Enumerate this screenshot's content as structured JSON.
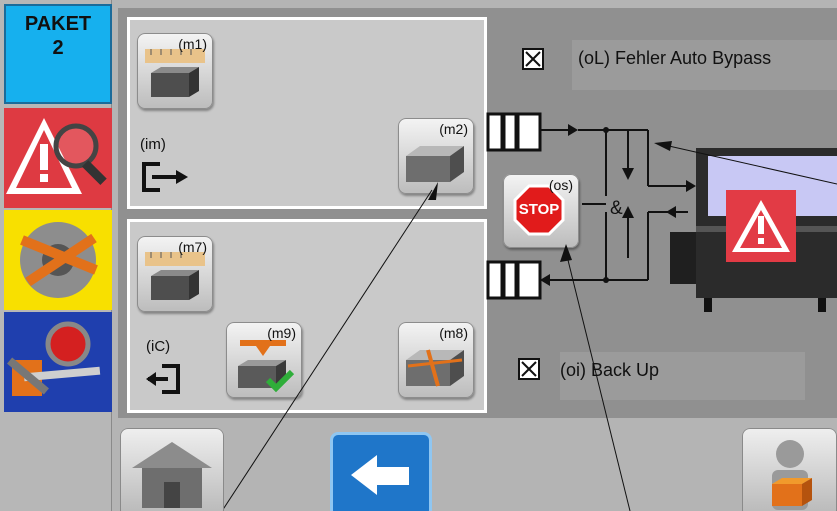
{
  "sidebar": {
    "paket_label": "PAKET",
    "paket_number": "2",
    "buttons": [
      {
        "name": "error-search",
        "color": "#de3a42",
        "icon": "warning-search-icon"
      },
      {
        "name": "wrap-roll",
        "color": "#f8e000",
        "icon": "film-roll-icon"
      },
      {
        "name": "search-tool",
        "color": "#1f3fae",
        "icon": "magnifier-tool-icon"
      }
    ]
  },
  "panel_top": {
    "m1_label": "(m1)",
    "m2_label": "(m2)",
    "mode_label": "(im)"
  },
  "panel_bottom": {
    "m7_label": "(m7)",
    "m8_label": "(m8)",
    "m9_label": "(m9)",
    "mode_label": "(iC)"
  },
  "stop": {
    "label": "(os)",
    "text": "STOP"
  },
  "logic": {
    "and_symbol": "&"
  },
  "options": {
    "auto_bypass": {
      "label": "(oL) Fehler Auto Bypass",
      "checked": true
    },
    "back_up": {
      "label": "(oi) Back Up",
      "checked": true
    }
  },
  "nav": {
    "home_icon": "house-icon",
    "back_icon": "arrow-left-icon",
    "user_icon": "operator-icon"
  },
  "colors": {
    "accent_blue": "#16b0ee",
    "alarm_red": "#e23b45",
    "machine_screen": "#c8c8f4"
  }
}
